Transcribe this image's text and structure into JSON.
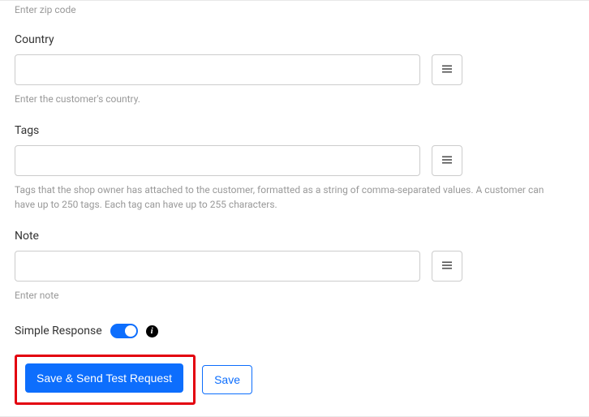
{
  "zipHelper": "Enter zip code",
  "fields": {
    "country": {
      "label": "Country",
      "value": "",
      "helper": "Enter the customer's country."
    },
    "tags": {
      "label": "Tags",
      "value": "",
      "helper": "Tags that the shop owner has attached to the customer, formatted as a string of comma-separated values. A customer can have up to 250 tags. Each tag can have up to 255 characters."
    },
    "note": {
      "label": "Note",
      "value": "",
      "helper": "Enter note"
    }
  },
  "simpleResponse": {
    "label": "Simple Response",
    "enabled": true
  },
  "buttons": {
    "saveSend": "Save & Send Test Request",
    "save": "Save"
  },
  "icons": {
    "menu": "menu-icon",
    "info": "i"
  }
}
